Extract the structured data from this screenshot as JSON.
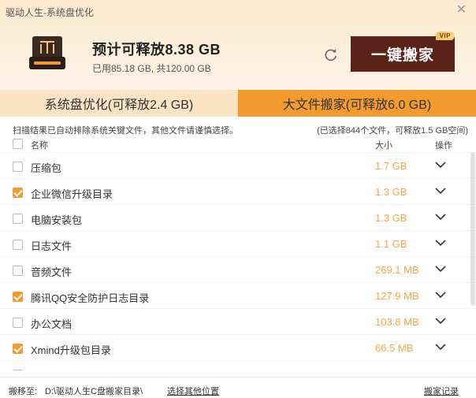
{
  "window": {
    "title": "驱动人生-系统盘优化"
  },
  "summary": {
    "title": "预计可释放8.38 GB",
    "used": "已用85.18 GB, 共120.00 GB"
  },
  "action": {
    "one_key_label": "一键搬家",
    "vip_badge": "VIP"
  },
  "tabs": [
    {
      "label": "系统盘优化(可释放2.4 GB)",
      "active": false
    },
    {
      "label": "大文件搬家(可释放6.0 GB)",
      "active": true
    }
  ],
  "hint": {
    "left": "扫描结果已自动排除系统关键文件，其他文件请谨慎选择。",
    "right": "(已选择844个文件，可释放1.5 GB空间)"
  },
  "columns": {
    "name": "名称",
    "size": "大小",
    "action": "操作"
  },
  "items": [
    {
      "name": "压缩包",
      "size": "1.7 GB",
      "checked": false
    },
    {
      "name": "企业微信升级目录",
      "size": "1.3 GB",
      "checked": true
    },
    {
      "name": "电脑安装包",
      "size": "1.3 GB",
      "checked": false
    },
    {
      "name": "日志文件",
      "size": "1.1 GB",
      "checked": false
    },
    {
      "name": "音频文件",
      "size": "269.1 MB",
      "checked": false
    },
    {
      "name": "腾讯QQ安全防护日志目录",
      "size": "127.9 MB",
      "checked": true
    },
    {
      "name": "办公文档",
      "size": "103.8 MB",
      "checked": false
    },
    {
      "name": "Xmind升级包目录",
      "size": "66.5 MB",
      "checked": true
    },
    {
      "name": "",
      "size": "",
      "checked": false
    }
  ],
  "footer": {
    "move_to_label": "搬移至:",
    "path": "D:\\驱动人生C盘搬家目录\\",
    "choose_other": "选择其他位置",
    "history": "搬家记录"
  },
  "colors": {
    "accent": "#f49b2f",
    "brand_dark": "#5a2218",
    "size_text": "#f5a742"
  }
}
